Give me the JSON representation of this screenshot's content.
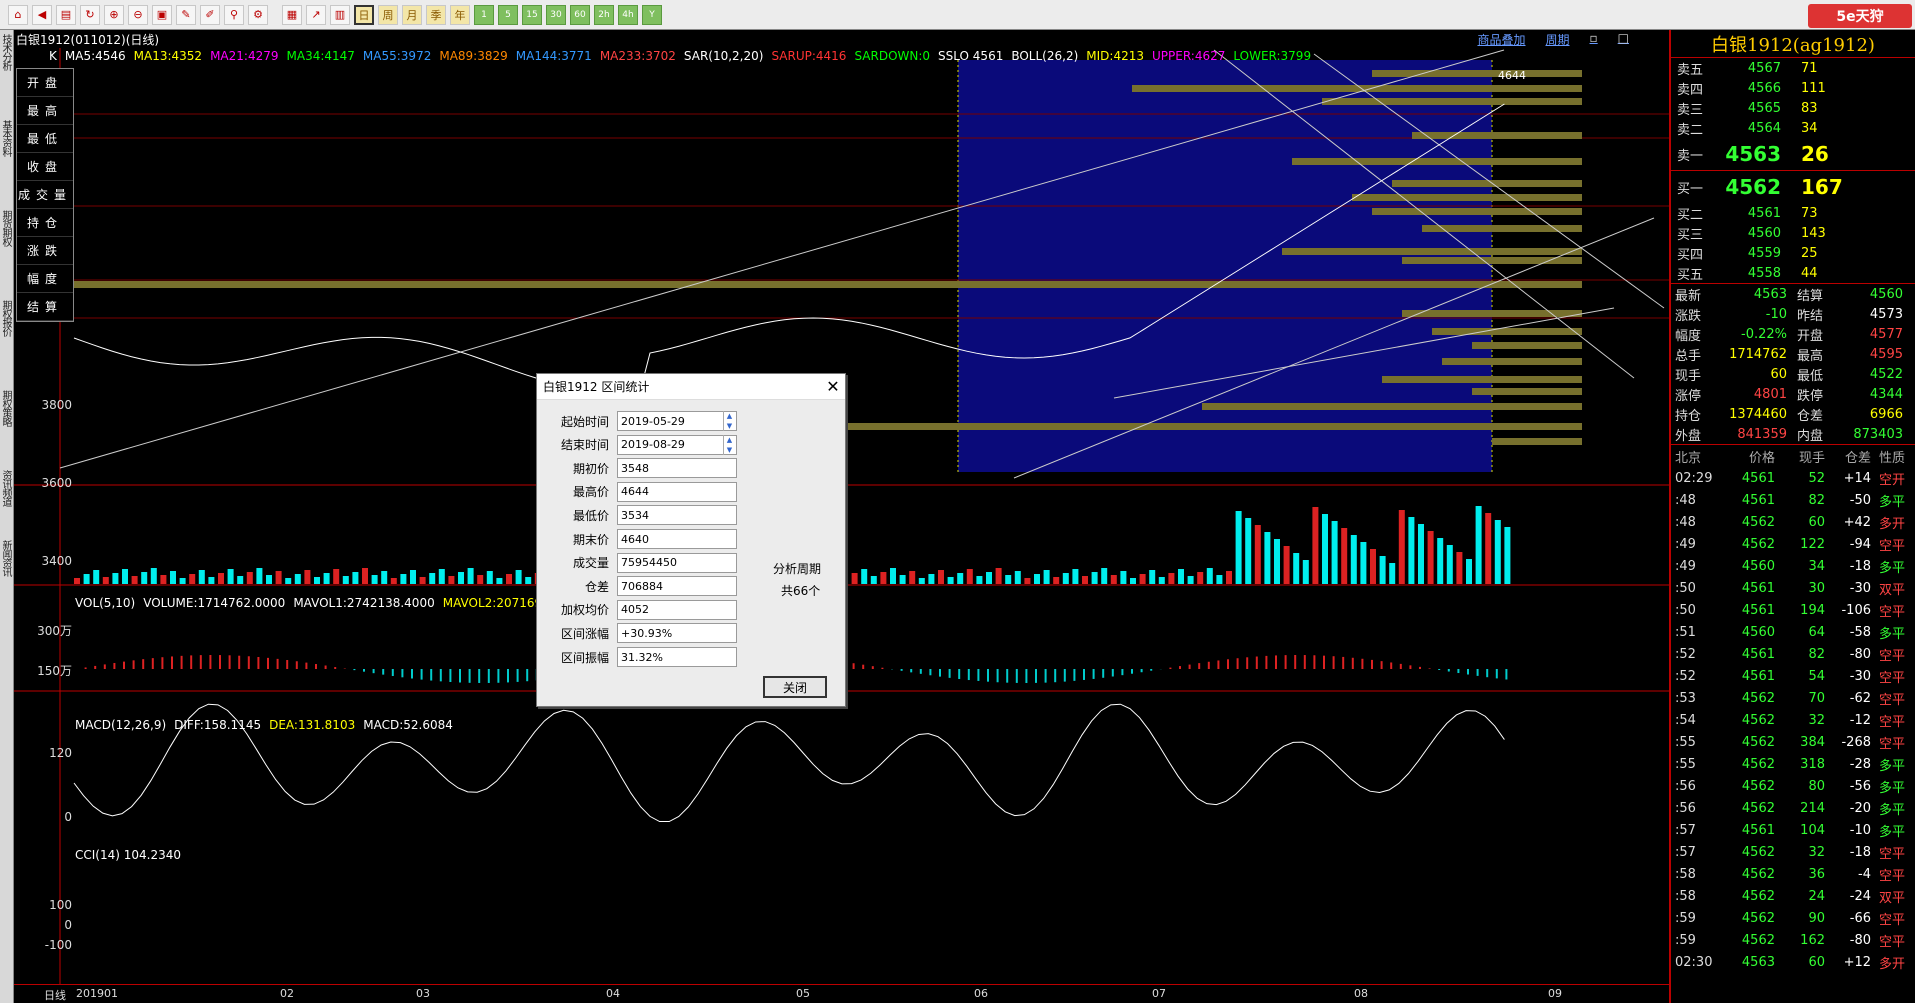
{
  "toolbar": {
    "period_icons": [
      "日",
      "周",
      "月",
      "季",
      "年",
      "1",
      "5",
      "15",
      "30",
      "60",
      "2h",
      "4h",
      "Y"
    ]
  },
  "left_tabs": [
    "技术分析",
    "基本资料",
    "期货期权",
    "期权报价",
    "期权策略",
    "资讯频道",
    "新闻资讯"
  ],
  "header": {
    "title": "白银1912(011012)(日线)",
    "right_links": [
      "商品叠加",
      "周期"
    ]
  },
  "chart": {
    "ma_label": "K",
    "indicators": [
      {
        "text": "MA5:4546",
        "color": "#ffffff"
      },
      {
        "text": "MA13:4352",
        "color": "#ffff00"
      },
      {
        "text": "MA21:4279",
        "color": "#ff00ff"
      },
      {
        "text": "MA34:4147",
        "color": "#00ff00"
      },
      {
        "text": "MA55:3972",
        "color": "#3399ff"
      },
      {
        "text": "MA89:3829",
        "color": "#ff8800"
      },
      {
        "text": "MA144:3771",
        "color": "#3399ff"
      },
      {
        "text": "MA233:3702",
        "color": "#ff4444"
      },
      {
        "text": "SAR(10,2,20)",
        "color": "#ffffff"
      },
      {
        "text": "SARUP:4416",
        "color": "#ff3333"
      },
      {
        "text": "SARDOWN:0",
        "color": "#00ff00"
      },
      {
        "text": "SSLO 4561",
        "color": "#ffffff"
      },
      {
        "text": "BOLL(26,2)",
        "color": "#ffffff"
      },
      {
        "text": "MID:4213",
        "color": "#ffff00"
      },
      {
        "text": "UPPER:4627",
        "color": "#ff00ff"
      },
      {
        "text": "LOWER:3799",
        "color": "#00ff00"
      }
    ],
    "price_ticks": [
      "3800",
      "3600",
      "3400"
    ],
    "peak_label": "4644",
    "ohlc_labels": [
      "开盘",
      "最高",
      "最低",
      "收盘",
      "成交量",
      "持仓",
      "涨跌",
      "幅度",
      "结算"
    ],
    "vol_labels": [
      {
        "text": "VOL(5,10)",
        "color": "#ffffff"
      },
      {
        "text": "VOLUME:1714762.0000",
        "color": "#ffffff"
      },
      {
        "text": "MAVOL1:2742138.4000",
        "color": "#ffffff"
      },
      {
        "text": "MAVOL2:2071692.000",
        "color": "#ffff00"
      }
    ],
    "vol_ticks": [
      "300万",
      "150万"
    ],
    "macd_labels": [
      {
        "text": "MACD(12,26,9)",
        "color": "#ffffff"
      },
      {
        "text": "DIFF:158.1145",
        "color": "#ffffff"
      },
      {
        "text": "DEA:131.8103",
        "color": "#ffff00"
      },
      {
        "text": "MACD:52.6084",
        "color": "#ffffff"
      }
    ],
    "macd_ticks": [
      "120",
      "0"
    ],
    "cci_label": "CCI(14) 104.2340",
    "cci_ticks": [
      "100",
      "0",
      "-100"
    ],
    "x_labels": [
      "日线",
      "201901",
      "02",
      "03",
      "04",
      "05",
      "06",
      "07",
      "08",
      "09"
    ]
  },
  "dialog": {
    "title": "白银1912 区间统计",
    "rows": [
      {
        "label": "起始时间",
        "value": "2019-05-29"
      },
      {
        "label": "结束时间",
        "value": "2019-08-29"
      },
      {
        "label": "期初价",
        "value": "3548"
      },
      {
        "label": "最高价",
        "value": "4644"
      },
      {
        "label": "最低价",
        "value": "3534"
      },
      {
        "label": "期末价",
        "value": "4640"
      },
      {
        "label": "成交量",
        "value": "75954450"
      },
      {
        "label": "仓差",
        "value": "706884"
      },
      {
        "label": "加权均价",
        "value": "4052"
      },
      {
        "label": "区间涨幅",
        "value": "+30.93%"
      },
      {
        "label": "区间振幅",
        "value": "31.32%"
      }
    ],
    "side1": "分析周期",
    "side2": "共66个",
    "close_label": "关闭"
  },
  "right": {
    "logo": "5e天狩",
    "title": "白银1912(ag1912)",
    "asks": [
      {
        "name": "卖五",
        "price": "4567",
        "vol": "71"
      },
      {
        "name": "卖四",
        "price": "4566",
        "vol": "111"
      },
      {
        "name": "卖三",
        "price": "4565",
        "vol": "83"
      },
      {
        "name": "卖二",
        "price": "4564",
        "vol": "34"
      },
      {
        "name": "卖一",
        "price": "4563",
        "vol": "26"
      }
    ],
    "bids": [
      {
        "name": "买一",
        "price": "4562",
        "vol": "167"
      },
      {
        "name": "买二",
        "price": "4561",
        "vol": "73"
      },
      {
        "name": "买三",
        "price": "4560",
        "vol": "143"
      },
      {
        "name": "买四",
        "price": "4559",
        "vol": "25"
      },
      {
        "name": "买五",
        "price": "4558",
        "vol": "44"
      }
    ],
    "stats": [
      {
        "k1": "最新",
        "v1": "4563",
        "c1": "#33ff33",
        "k2": "结算",
        "v2": "4560",
        "c2": "#33ff33"
      },
      {
        "k1": "涨跌",
        "v1": "-10",
        "c1": "#33ff33",
        "k2": "昨结",
        "v2": "4573",
        "c2": "#ffffff"
      },
      {
        "k1": "幅度",
        "v1": "-0.22%",
        "c1": "#33ff33",
        "k2": "开盘",
        "v2": "4577",
        "c2": "#ff4444"
      },
      {
        "k1": "总手",
        "v1": "1714762",
        "c1": "#ffff00",
        "k2": "最高",
        "v2": "4595",
        "c2": "#ff4444"
      },
      {
        "k1": "现手",
        "v1": "60",
        "c1": "#ffff00",
        "k2": "最低",
        "v2": "4522",
        "c2": "#33ff33"
      },
      {
        "k1": "涨停",
        "v1": "4801",
        "c1": "#ff4444",
        "k2": "跌停",
        "v2": "4344",
        "c2": "#33ff33"
      },
      {
        "k1": "持仓",
        "v1": "1374460",
        "c1": "#ffff00",
        "k2": "仓差",
        "v2": "6966",
        "c2": "#ffff00"
      },
      {
        "k1": "外盘",
        "v1": "841359",
        "c1": "#ff4444",
        "k2": "内盘",
        "v2": "873403",
        "c2": "#33ff33"
      }
    ],
    "tick_header": [
      "北京",
      "价格",
      "现手",
      "仓差",
      "性质"
    ],
    "ticks": [
      {
        "t": "02:29",
        "p": "4561",
        "v": "52",
        "d": "+14",
        "ty": "空开",
        "dc": "#ffffff",
        "tc": "#ff4444"
      },
      {
        "t": ":48",
        "p": "4561",
        "v": "82",
        "d": "-50",
        "ty": "多平",
        "dc": "#ffffff",
        "tc": "#33ff33"
      },
      {
        "t": ":48",
        "p": "4562",
        "v": "60",
        "d": "+42",
        "ty": "多开",
        "dc": "#ffffff",
        "tc": "#ff4444"
      },
      {
        "t": ":49",
        "p": "4562",
        "v": "122",
        "d": "-94",
        "ty": "空平",
        "dc": "#ffffff",
        "tc": "#ff4444"
      },
      {
        "t": ":49",
        "p": "4560",
        "v": "34",
        "d": "-18",
        "ty": "多平",
        "dc": "#ffffff",
        "tc": "#33ff33"
      },
      {
        "t": ":50",
        "p": "4561",
        "v": "30",
        "d": "-30",
        "ty": "双平",
        "dc": "#ffffff",
        "tc": "#ff4444"
      },
      {
        "t": ":50",
        "p": "4561",
        "v": "194",
        "d": "-106",
        "ty": "空平",
        "dc": "#ffffff",
        "tc": "#ff4444"
      },
      {
        "t": ":51",
        "p": "4560",
        "v": "64",
        "d": "-58",
        "ty": "多平",
        "dc": "#ffffff",
        "tc": "#33ff33"
      },
      {
        "t": ":52",
        "p": "4561",
        "v": "82",
        "d": "-80",
        "ty": "空平",
        "dc": "#ffffff",
        "tc": "#ff4444"
      },
      {
        "t": ":52",
        "p": "4561",
        "v": "54",
        "d": "-30",
        "ty": "空平",
        "dc": "#ffffff",
        "tc": "#ff4444"
      },
      {
        "t": ":53",
        "p": "4562",
        "v": "70",
        "d": "-62",
        "ty": "空平",
        "dc": "#ffffff",
        "tc": "#ff4444"
      },
      {
        "t": ":54",
        "p": "4562",
        "v": "32",
        "d": "-12",
        "ty": "空平",
        "dc": "#ffffff",
        "tc": "#ff4444"
      },
      {
        "t": ":55",
        "p": "4562",
        "v": "384",
        "d": "-268",
        "ty": "空平",
        "dc": "#ffffff",
        "tc": "#ff4444"
      },
      {
        "t": ":55",
        "p": "4562",
        "v": "318",
        "d": "-28",
        "ty": "多平",
        "dc": "#ffffff",
        "tc": "#33ff33"
      },
      {
        "t": ":56",
        "p": "4562",
        "v": "80",
        "d": "-56",
        "ty": "多平",
        "dc": "#ffffff",
        "tc": "#33ff33"
      },
      {
        "t": ":56",
        "p": "4562",
        "v": "214",
        "d": "-20",
        "ty": "多平",
        "dc": "#ffffff",
        "tc": "#33ff33"
      },
      {
        "t": ":57",
        "p": "4561",
        "v": "104",
        "d": "-10",
        "ty": "多平",
        "dc": "#ffffff",
        "tc": "#33ff33"
      },
      {
        "t": ":57",
        "p": "4562",
        "v": "32",
        "d": "-18",
        "ty": "空平",
        "dc": "#ffffff",
        "tc": "#ff4444"
      },
      {
        "t": ":58",
        "p": "4562",
        "v": "36",
        "d": "-4",
        "ty": "空平",
        "dc": "#ffffff",
        "tc": "#ff4444"
      },
      {
        "t": ":58",
        "p": "4562",
        "v": "24",
        "d": "-24",
        "ty": "双平",
        "dc": "#ffffff",
        "tc": "#ff4444"
      },
      {
        "t": ":59",
        "p": "4562",
        "v": "90",
        "d": "-66",
        "ty": "空平",
        "dc": "#ffffff",
        "tc": "#ff4444"
      },
      {
        "t": ":59",
        "p": "4562",
        "v": "162",
        "d": "-80",
        "ty": "空平",
        "dc": "#ffffff",
        "tc": "#ff4444"
      },
      {
        "t": "02:30",
        "p": "4563",
        "v": "60",
        "d": "+12",
        "ty": "多开",
        "dc": "#ffffff",
        "tc": "#ff4444"
      }
    ]
  }
}
